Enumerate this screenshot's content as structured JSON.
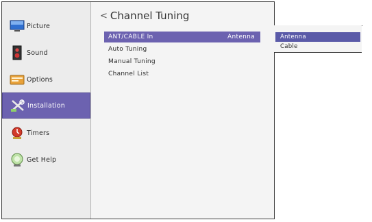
{
  "sidebar": {
    "items": [
      {
        "label": "Picture",
        "icon": "picture-icon"
      },
      {
        "label": "Sound",
        "icon": "sound-icon"
      },
      {
        "label": "Options",
        "icon": "options-icon"
      },
      {
        "label": "Installation",
        "icon": "installation-icon",
        "active": true
      },
      {
        "label": "Timers",
        "icon": "timers-icon"
      },
      {
        "label": "Get Help",
        "icon": "help-icon"
      }
    ]
  },
  "main": {
    "back_glyph": "<",
    "title": "Channel Tuning",
    "rows": [
      {
        "label": "ANT/CABLE In",
        "value": "Antenna",
        "selected": true
      },
      {
        "label": "Auto Tuning",
        "value": ""
      },
      {
        "label": "Manual Tuning",
        "value": ""
      },
      {
        "label": "Channel List",
        "value": ""
      }
    ]
  },
  "popup": {
    "options": [
      {
        "label": "Antenna",
        "selected": true
      },
      {
        "label": "Cable",
        "selected": false
      }
    ]
  },
  "colors": {
    "accent": "#6c62b0",
    "popup_accent": "#5a5aa8"
  }
}
